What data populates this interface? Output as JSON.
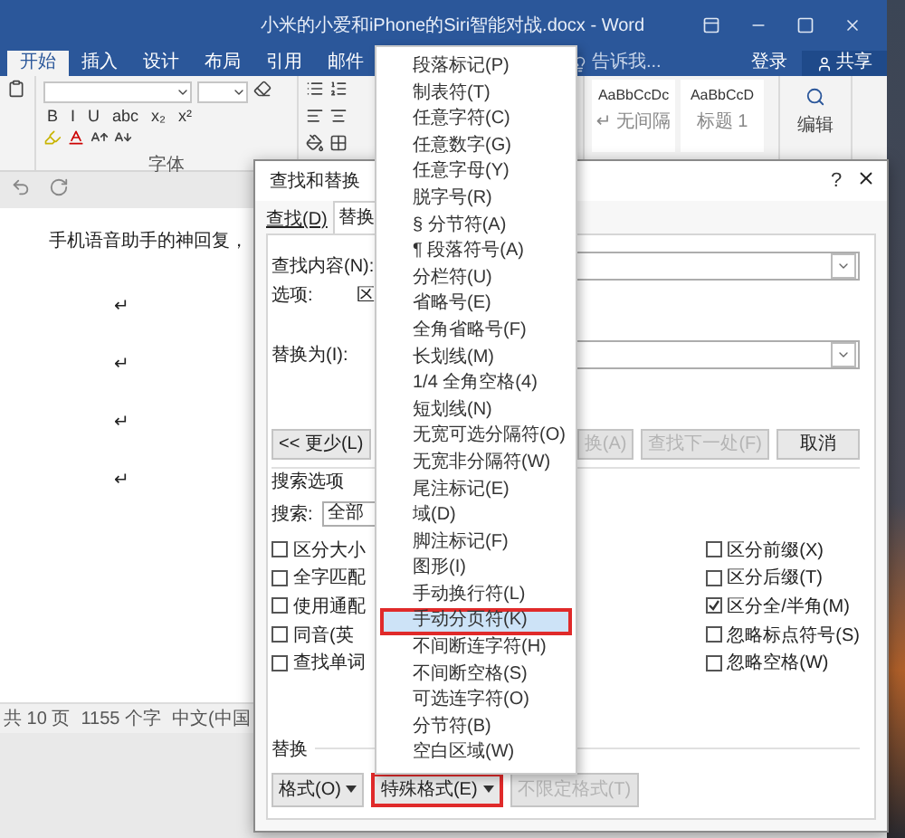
{
  "word": {
    "title": "小米的小爱和iPhone的Siri智能对战.docx - Word",
    "tabs": [
      {
        "label": "开始",
        "selected": true
      },
      {
        "label": "插入",
        "selected": false
      },
      {
        "label": "设计",
        "selected": false
      },
      {
        "label": "布局",
        "selected": false
      },
      {
        "label": "引用",
        "selected": false
      },
      {
        "label": "邮件",
        "selected": false
      }
    ],
    "tell_me": "告诉我...",
    "login": "登录",
    "share": "共享",
    "format_buttons": [
      "B",
      "I",
      "U",
      "abc",
      "x₂",
      "x²"
    ],
    "font_group_label": "字体",
    "styles": [
      {
        "preview": "AaBbCcDc",
        "name": "↵ 无间隔"
      },
      {
        "preview": "AaBbCcD",
        "name": "标题 1"
      }
    ],
    "editing_label": "编辑",
    "document_lines": [
      "手机语音助手的神回复，",
      "↵",
      "↵",
      "↵",
      "↵"
    ],
    "status_bar": [
      "共 10 页",
      "1155 个字",
      "中文(中国"
    ]
  },
  "dialog": {
    "title": "查找和替换",
    "tabs": [
      {
        "label": "查找(D)",
        "selected": false
      },
      {
        "label": "替换",
        "selected": true
      }
    ],
    "help": "?",
    "find_label": "查找内容(N):",
    "options_label": "选项:",
    "options_value": "区",
    "replace_label": "替换为(I):",
    "buttons": [
      {
        "label": "<< 更少(L)",
        "disabled": false
      },
      {
        "label": "换(A)",
        "disabled": true
      },
      {
        "label": "查找下一处(F)",
        "disabled": true
      },
      {
        "label": "取消",
        "disabled": false
      }
    ],
    "search_options_label": "搜索选项",
    "search_label": "搜索:",
    "search_value": "全部",
    "left_options": [
      {
        "label": "区分大小",
        "checked": false
      },
      {
        "label": "全字匹配",
        "checked": false
      },
      {
        "label": "使用通配",
        "checked": false
      },
      {
        "label": "同音(英",
        "checked": false
      },
      {
        "label": "查找单词",
        "checked": false
      }
    ],
    "right_options": [
      {
        "label": "区分前缀(X)",
        "checked": false
      },
      {
        "label": "区分后缀(T)",
        "checked": false
      },
      {
        "label": "区分全/半角(M)",
        "checked": true
      },
      {
        "label": "忽略标点符号(S)",
        "checked": false
      },
      {
        "label": "忽略空格(W)",
        "checked": false
      }
    ],
    "replace_section_label": "替换",
    "format_buttons": [
      {
        "label": "格式(O)",
        "disabled": false,
        "marked": false,
        "dropdown": true
      },
      {
        "label": "特殊格式(E)",
        "disabled": false,
        "marked": true,
        "dropdown": true
      },
      {
        "label": "不限定格式(T)",
        "disabled": true,
        "marked": false,
        "dropdown": false
      }
    ]
  },
  "special_menu": {
    "items": [
      {
        "label": "段落标记(P)",
        "selected": false,
        "marked": false
      },
      {
        "label": "制表符(T)",
        "selected": false,
        "marked": false
      },
      {
        "label": "任意字符(C)",
        "selected": false,
        "marked": false
      },
      {
        "label": "任意数字(G)",
        "selected": false,
        "marked": false
      },
      {
        "label": "任意字母(Y)",
        "selected": false,
        "marked": false
      },
      {
        "label": "脱字号(R)",
        "selected": false,
        "marked": false
      },
      {
        "label": "§ 分节符(A)",
        "selected": false,
        "marked": false
      },
      {
        "label": "¶ 段落符号(A)",
        "selected": false,
        "marked": false
      },
      {
        "label": "分栏符(U)",
        "selected": false,
        "marked": false
      },
      {
        "label": "省略号(E)",
        "selected": false,
        "marked": false
      },
      {
        "label": "全角省略号(F)",
        "selected": false,
        "marked": false
      },
      {
        "label": "长划线(M)",
        "selected": false,
        "marked": false
      },
      {
        "label": "1/4 全角空格(4)",
        "selected": false,
        "marked": false
      },
      {
        "label": "短划线(N)",
        "selected": false,
        "marked": false
      },
      {
        "label": "无宽可选分隔符(O)",
        "selected": false,
        "marked": false
      },
      {
        "label": "无宽非分隔符(W)",
        "selected": false,
        "marked": false
      },
      {
        "label": "尾注标记(E)",
        "selected": false,
        "marked": false
      },
      {
        "label": "域(D)",
        "selected": false,
        "marked": false
      },
      {
        "label": "脚注标记(F)",
        "selected": false,
        "marked": false
      },
      {
        "label": "图形(I)",
        "selected": false,
        "marked": false
      },
      {
        "label": "手动换行符(L)",
        "selected": false,
        "marked": false
      },
      {
        "label": "手动分页符(K)",
        "selected": true,
        "marked": true
      },
      {
        "label": "不间断连字符(H)",
        "selected": false,
        "marked": false
      },
      {
        "label": "不间断空格(S)",
        "selected": false,
        "marked": false
      },
      {
        "label": "可选连字符(O)",
        "selected": false,
        "marked": false
      },
      {
        "label": "分节符(B)",
        "selected": false,
        "marked": false
      },
      {
        "label": "空白区域(W)",
        "selected": false,
        "marked": false
      }
    ]
  }
}
